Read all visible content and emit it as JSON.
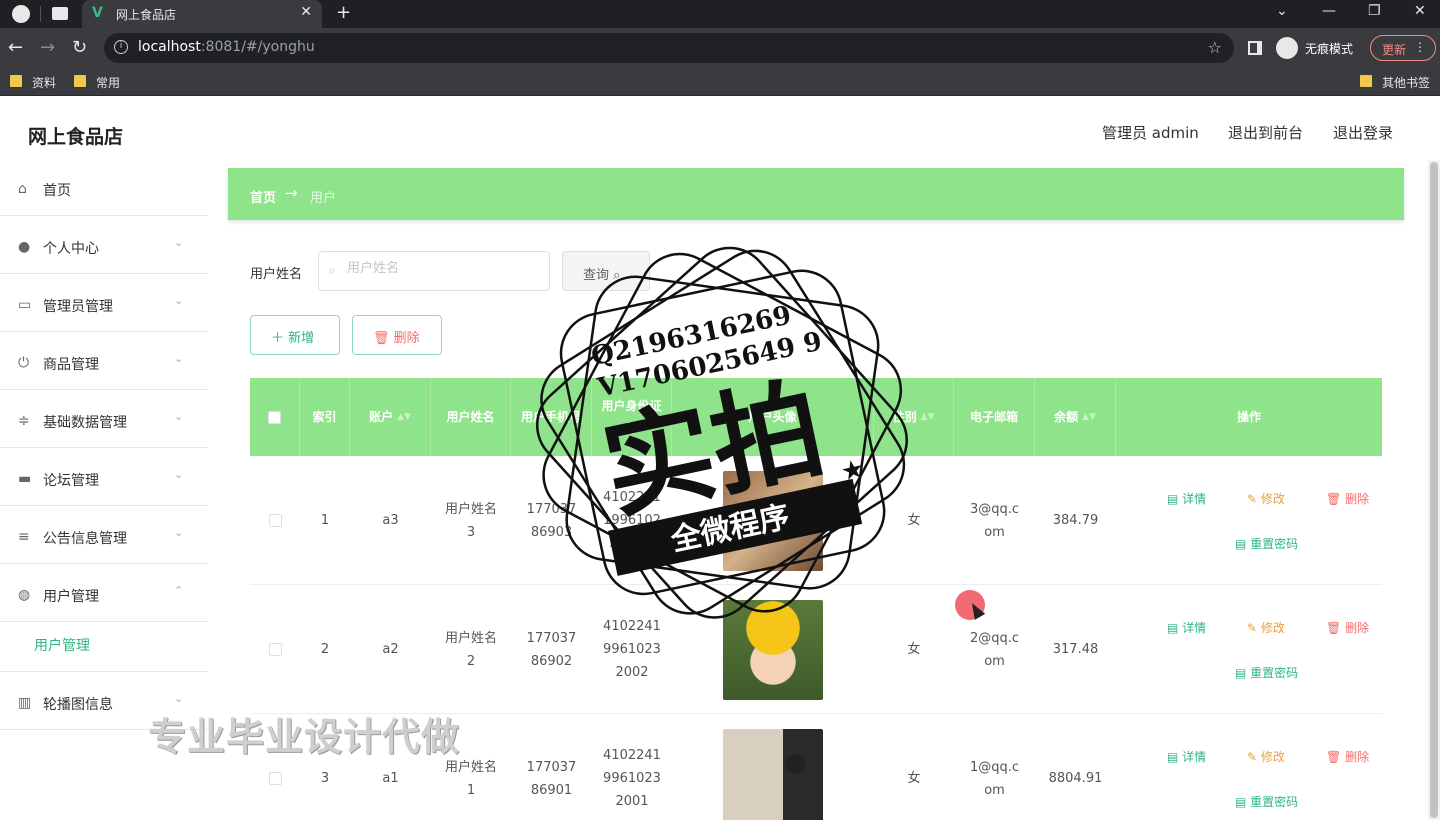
{
  "browser": {
    "tab_title": "网上食品店",
    "url_host": "localhost",
    "url_rest": ":8081/#/yonghu",
    "incognito_label": "无痕模式",
    "update_label": "更新",
    "bookmarks": [
      "资料",
      "常用"
    ],
    "other_bookmarks": "其他书签"
  },
  "app": {
    "title": "网上食品店",
    "admin_label": "管理员 admin",
    "to_front": "退出到前台",
    "logout": "退出登录"
  },
  "sidebar": {
    "items": [
      {
        "label": "首页",
        "icon": "home-icon"
      },
      {
        "label": "个人中心",
        "icon": "user-icon"
      },
      {
        "label": "管理员管理",
        "icon": "id-card-icon"
      },
      {
        "label": "商品管理",
        "icon": "power-icon"
      },
      {
        "label": "基础数据管理",
        "icon": "sliders-icon"
      },
      {
        "label": "论坛管理",
        "icon": "chat-icon"
      },
      {
        "label": "公告信息管理",
        "icon": "list-icon"
      },
      {
        "label": "用户管理",
        "icon": "globe-icon"
      },
      {
        "label": "轮播图信息",
        "icon": "bar-chart-icon"
      }
    ],
    "sub_active": "用户管理"
  },
  "breadcrumb": {
    "home": "首页",
    "current": "用户"
  },
  "search": {
    "label": "用户姓名",
    "placeholder": "用户姓名",
    "button": "查询"
  },
  "actions": {
    "add": "新增",
    "delete": "删除"
  },
  "table": {
    "headers": [
      "索引",
      "账户",
      "用户姓名",
      "用户手机号",
      "用户身份证号",
      "用户头像",
      "性别",
      "电子邮箱",
      "余额",
      "操作"
    ],
    "rows": [
      {
        "index": "1",
        "account": "a3",
        "name": "用户姓名3",
        "phone": "17703786903",
        "idcard": "410224119961023 2003",
        "gender": "女",
        "email": "3@qq.com",
        "balance": "384.79"
      },
      {
        "index": "2",
        "account": "a2",
        "name": "用户姓名2",
        "phone": "17703786902",
        "idcard": "410224199610232002",
        "gender": "女",
        "email": "2@qq.com",
        "balance": "317.48"
      },
      {
        "index": "3",
        "account": "a1",
        "name": "用户姓名1",
        "phone": "17703786901",
        "idcard": "410224199610232001",
        "gender": "女",
        "email": "1@qq.com",
        "balance": "8804.91"
      }
    ],
    "row_actions": {
      "detail": "详情",
      "edit": "修改",
      "remove": "删除",
      "reset": "重置密码"
    }
  },
  "overlay": {
    "qq": "Q2196316269",
    "vx": "V1706025649 9",
    "big": "实拍",
    "banner": "全微程序",
    "bottom": "专业毕业设计代做"
  }
}
